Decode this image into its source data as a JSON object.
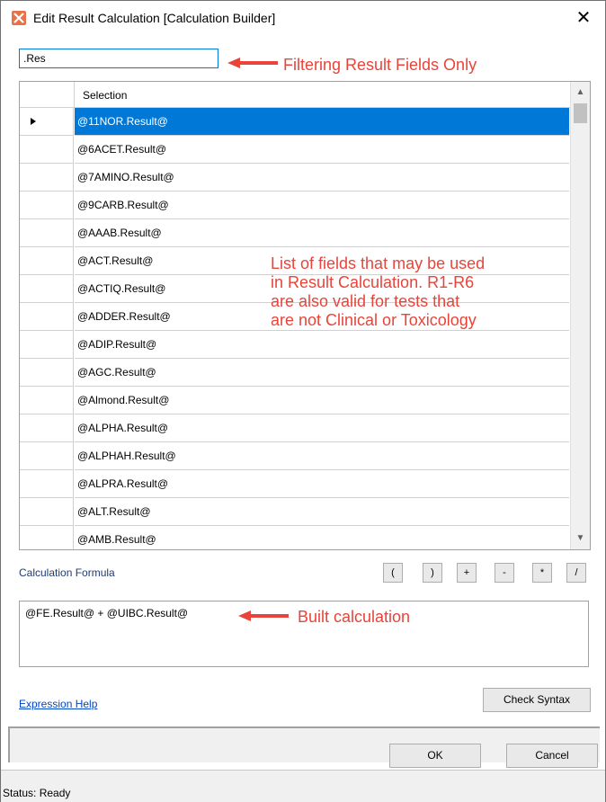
{
  "window": {
    "title": "Edit Result Calculation [Calculation Builder]",
    "close_label": "✕"
  },
  "filter": {
    "value": ".Res"
  },
  "annotations": {
    "filter_note": "Filtering Result Fields Only",
    "list_note": [
      "List of fields that may be used",
      "in Result Calculation. R1-R6",
      "are also valid for tests that",
      "are not Clinical or Toxicology"
    ],
    "built_note": "Built calculation",
    "color": "#e8443a"
  },
  "grid": {
    "header": "Selection",
    "rows": [
      "@11NOR.Result@",
      "@6ACET.Result@",
      "@7AMINO.Result@",
      "@9CARB.Result@",
      "@AAAB.Result@",
      "@ACT.Result@",
      "@ACTIQ.Result@",
      "@ADDER.Result@",
      "@ADIP.Result@",
      "@AGC.Result@",
      "@Almond.Result@",
      "@ALPHA.Result@",
      "@ALPHAH.Result@",
      "@ALPRA.Result@",
      "@ALT.Result@",
      "@AMB.Result@"
    ],
    "selected_index": 0
  },
  "calc": {
    "label": "Calculation Formula",
    "operators": [
      "(",
      ")",
      "+",
      "-",
      "*",
      "/"
    ],
    "formula": "@FE.Result@ + @UIBC.Result@"
  },
  "links": {
    "expression_help": "Expression Help"
  },
  "buttons": {
    "check_syntax": "Check Syntax",
    "ok": "OK",
    "cancel": "Cancel"
  },
  "status": {
    "text": "Status: Ready"
  },
  "colors": {
    "selection": "#0078d7",
    "label_blue": "#1f3b73",
    "link_blue": "#0046c8"
  }
}
